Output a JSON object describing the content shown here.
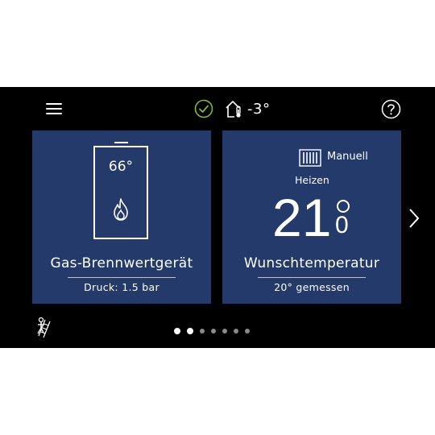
{
  "header": {
    "outdoor_temperature": "-3°"
  },
  "cards": [
    {
      "boiler_temperature": "66°",
      "title": "Gas-Brennwertgerät",
      "subtitle": "Druck: 1.5 bar"
    },
    {
      "mode": "Manuell",
      "status": "Heizen",
      "setpoint_main": "21",
      "setpoint_fraction": "0",
      "title": "Wunschtemperatur",
      "subtitle": "20° gemessen"
    }
  ],
  "pagination": {
    "total_pages": 7,
    "active_pages": [
      1,
      2
    ]
  },
  "colors": {
    "card_background": "#243a6a",
    "status_ok": "#7fb83a",
    "screen_background": "#000000"
  },
  "icons": [
    "menu-icon",
    "check-circle-icon",
    "house-thermometer-icon",
    "help-icon",
    "boiler-icon",
    "flame-icon",
    "radiator-icon",
    "chevron-right-icon",
    "chimney-sweep-icon"
  ]
}
